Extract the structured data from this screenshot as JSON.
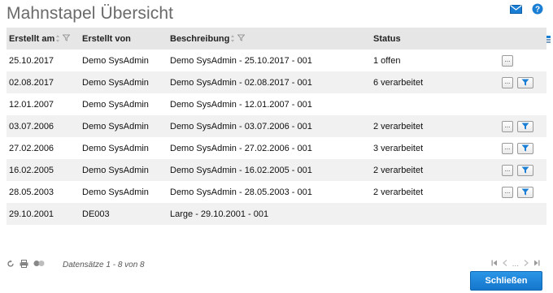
{
  "page": {
    "title": "Mahnstapel Übersicht"
  },
  "header_icons": [
    "mail-icon",
    "help-icon"
  ],
  "table": {
    "columns": {
      "created_on": "Erstellt am",
      "created_by": "Erstellt von",
      "description": "Beschreibung",
      "status": "Status"
    },
    "rows": [
      {
        "created_on": "25.10.2017",
        "created_by": "Demo SysAdmin",
        "description": "Demo SysAdmin - 25.10.2017 - 001",
        "status": "1 offen",
        "actions": [
          "more"
        ]
      },
      {
        "created_on": "02.08.2017",
        "created_by": "Demo SysAdmin",
        "description": "Demo SysAdmin - 02.08.2017 - 001",
        "status": "6 verarbeitet",
        "actions": [
          "more",
          "filter"
        ]
      },
      {
        "created_on": "12.01.2007",
        "created_by": "Demo SysAdmin",
        "description": "Demo SysAdmin - 12.01.2007 - 001",
        "status": "",
        "actions": []
      },
      {
        "created_on": "03.07.2006",
        "created_by": "Demo SysAdmin",
        "description": "Demo SysAdmin - 03.07.2006 - 001",
        "status": "2 verarbeitet",
        "actions": [
          "more",
          "filter"
        ]
      },
      {
        "created_on": "27.02.2006",
        "created_by": "Demo SysAdmin",
        "description": "Demo SysAdmin - 27.02.2006 - 001",
        "status": "3 verarbeitet",
        "actions": [
          "more",
          "filter"
        ]
      },
      {
        "created_on": "16.02.2005",
        "created_by": "Demo SysAdmin",
        "description": "Demo SysAdmin - 16.02.2005 - 001",
        "status": "2 verarbeitet",
        "actions": [
          "more",
          "filter"
        ]
      },
      {
        "created_on": "28.05.2003",
        "created_by": "Demo SysAdmin",
        "description": "Demo SysAdmin - 28.05.2003 - 001",
        "status": "2 verarbeitet",
        "actions": [
          "more",
          "filter"
        ]
      },
      {
        "created_on": "29.10.2001",
        "created_by": "DE003",
        "description": "Large - 29.10.2001 - 001",
        "status": "",
        "actions": []
      }
    ]
  },
  "footer": {
    "records_text": "Datensätze 1 - 8 von 8",
    "pager_gap": "..."
  },
  "buttons": {
    "more_label": "...",
    "close_label": "Schließen"
  },
  "colors": {
    "accent": "#1a7fd4",
    "header_bg": "#e6e6e6",
    "row_alt_bg": "#f1f1f1",
    "title": "#6a6a6a"
  }
}
